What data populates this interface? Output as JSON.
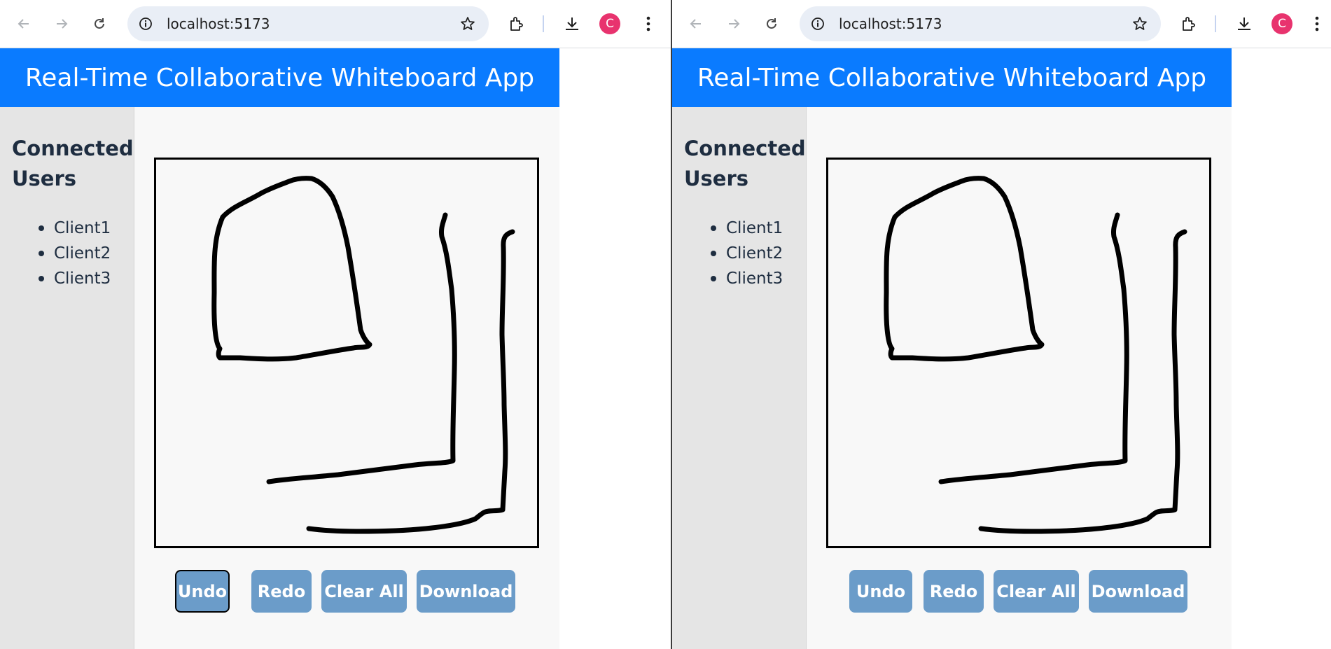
{
  "browser": {
    "url": "localhost:5173",
    "profile_initial": "C",
    "profile_color": "#e8336e"
  },
  "app": {
    "title": "Real-Time Collaborative Whiteboard App",
    "header_color": "#0a7bff",
    "sidebar": {
      "title": "Connected Users",
      "users": [
        "Client1",
        "Client2",
        "Client3"
      ]
    },
    "buttons": {
      "undo": "Undo",
      "redo": "Redo",
      "clear": "Clear All",
      "download": "Download"
    },
    "button_color": "#6b9cc9"
  },
  "icons": [
    "back-arrow-icon",
    "forward-arrow-icon",
    "reload-icon",
    "site-info-icon",
    "bookmark-star-icon",
    "extensions-icon",
    "download-icon",
    "more-menu-icon"
  ]
}
